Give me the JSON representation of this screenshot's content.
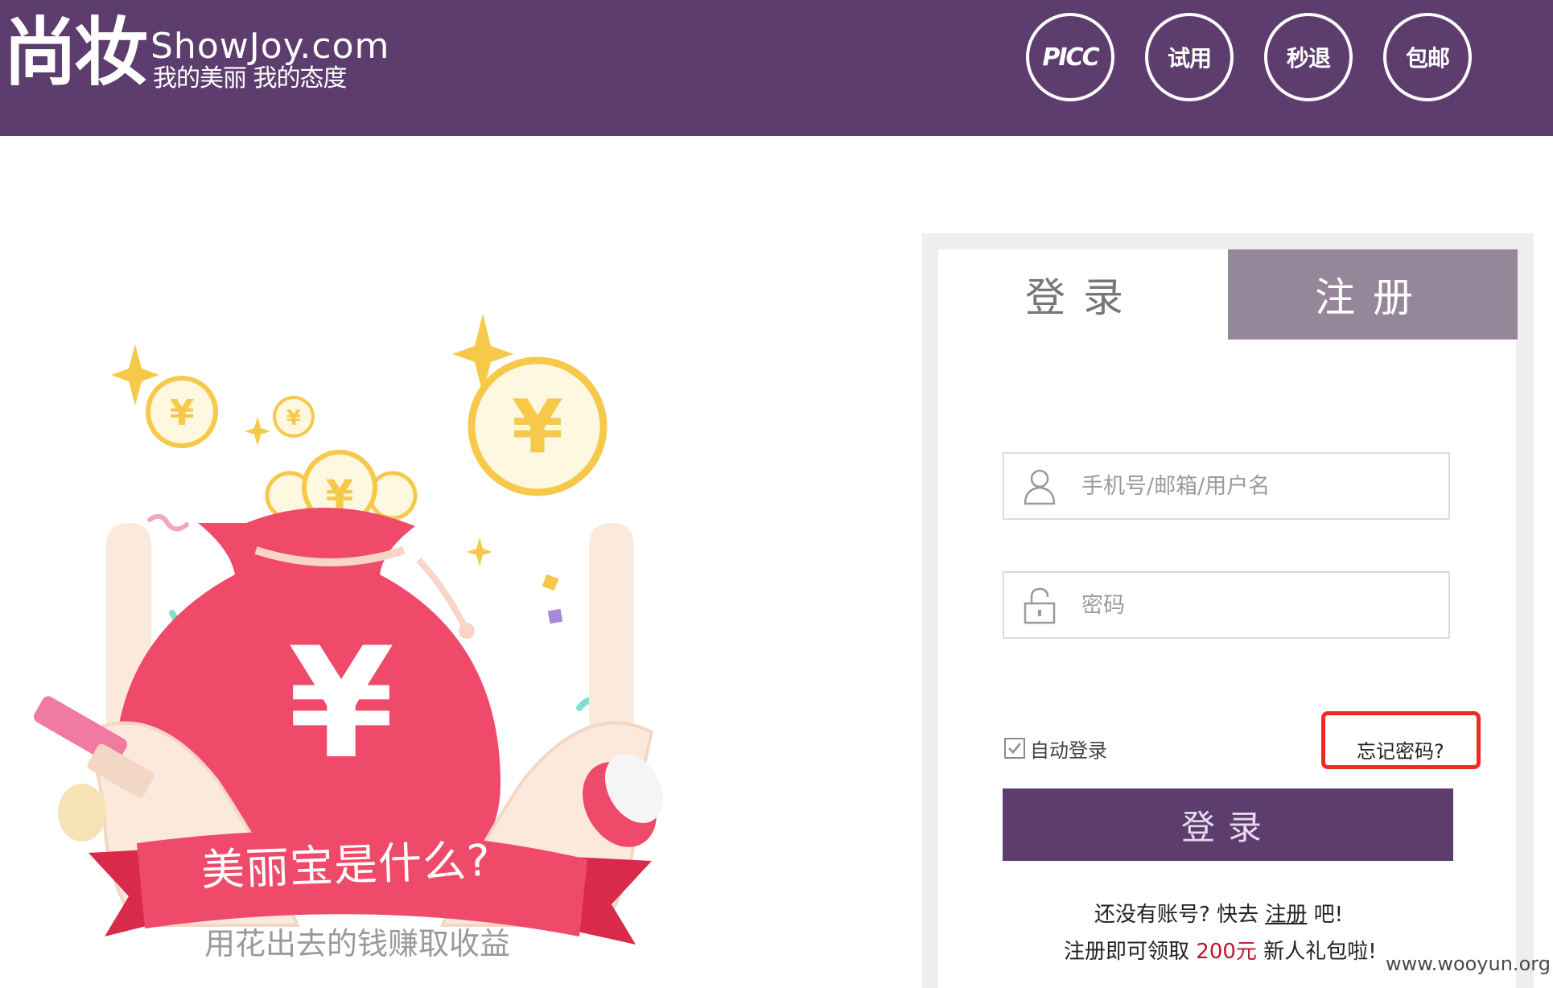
{
  "header": {
    "logo_cn": "尚妆",
    "logo_en": "ShowJoy.com",
    "slogan": "我的美丽 我的态度",
    "badges": [
      "PICC",
      "试用",
      "秒退",
      "包邮"
    ],
    "background_color": "#5c3d6d"
  },
  "illustration": {
    "title": "美丽宝是什么?",
    "subtitle": "用花出去的钱赚取收益",
    "coin_symbol": "¥"
  },
  "login": {
    "tabs": [
      "登录",
      "注册"
    ],
    "username_placeholder": "手机号/邮箱/用户名",
    "password_placeholder": "密码",
    "auto_login_label": "自动登录",
    "auto_login_checked": true,
    "forgot_password": "忘记密码?",
    "submit_label": "登录",
    "no_account_prefix": "还没有账号? 快去",
    "register_link": "注册",
    "no_account_suffix": "吧!",
    "gift_prefix": "注册即可领取",
    "gift_amount": "200元",
    "gift_suffix": "新人礼包啦!",
    "highlight_color": "#ee2b23",
    "button_color": "#5c3d6d",
    "register_tab_color": "#968699"
  },
  "watermark": "www.wooyun.org"
}
